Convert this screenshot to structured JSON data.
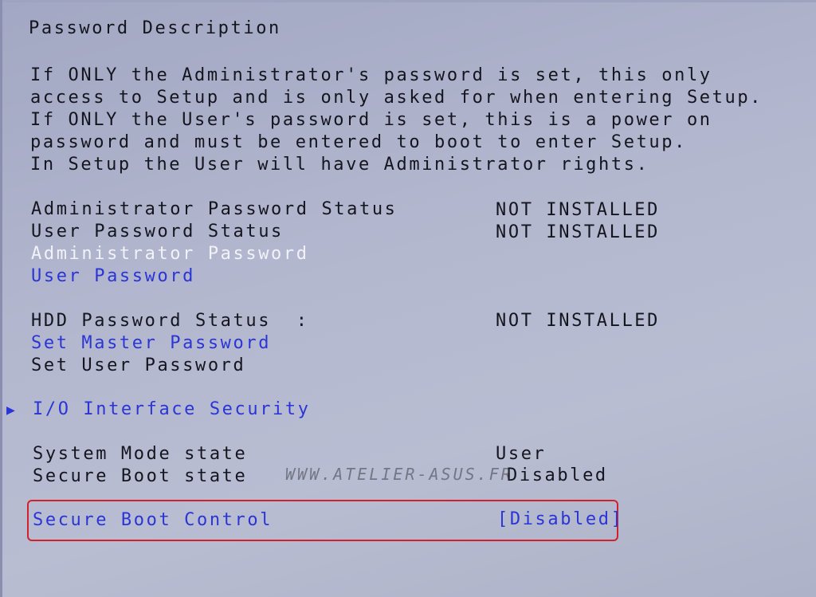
{
  "description": {
    "title": "Password Description",
    "lines": [
      "If ONLY the Administrator's password is set, this only",
      "access to Setup and is only asked for when entering Setup.",
      "If ONLY the User's password is set, this is a power on",
      "password and must be entered to boot to enter Setup.",
      "In Setup the User will have Administrator rights."
    ]
  },
  "password_status": {
    "admin_status_label": "Administrator Password Status",
    "admin_status_value": "NOT INSTALLED",
    "user_status_label": "User Password Status",
    "user_status_value": "NOT INSTALLED",
    "admin_password_label": "Administrator Password",
    "user_password_label": "User Password"
  },
  "hdd": {
    "status_label": "HDD Password Status  :",
    "status_value": "NOT INSTALLED",
    "set_master_label": "Set Master Password",
    "set_user_label": "Set User Password"
  },
  "io_security": {
    "arrow": "▶",
    "label": "I/O Interface Security"
  },
  "secure_boot": {
    "system_mode_label": "System Mode state",
    "system_mode_value": "User",
    "secure_boot_state_label": "Secure Boot state",
    "secure_boot_state_value": "Disabled",
    "control_label": "Secure Boot Control",
    "control_value": "[Disabled]"
  },
  "watermark": "WWW.ATELIER-ASUS.FR",
  "colors": {
    "background": "#b4b8cf",
    "selectable_blue": "#2b35d6",
    "selected_white": "#f2f2f8",
    "highlight_border": "#d2202c"
  }
}
